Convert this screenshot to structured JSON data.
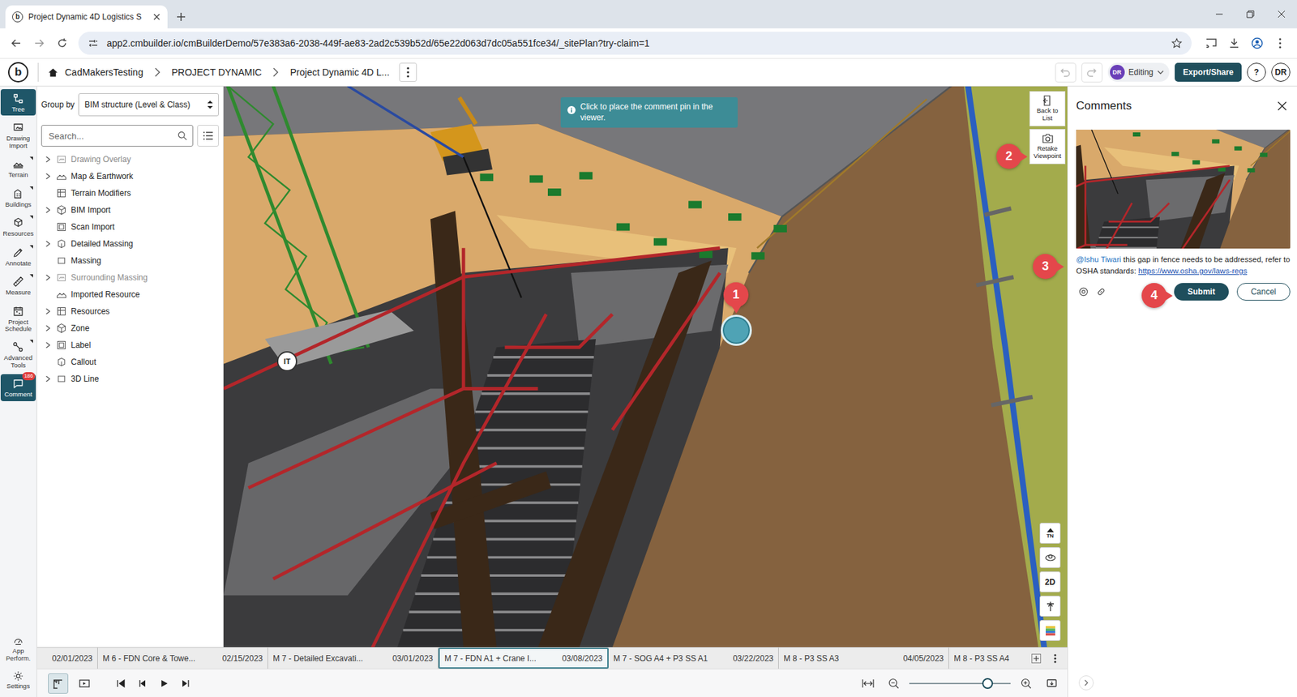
{
  "browser": {
    "tab_title": "Project Dynamic 4D Logistics S",
    "url": "app2.cmbuilder.io/cmBuilderDemo/57e383a6-2038-449f-ae83-2ad2c539b52d/65e22d063d7dc05a551fce34/_sitePlan?try-claim=1"
  },
  "app_header": {
    "logo": "b",
    "breadcrumbs": [
      "CadMakersTesting",
      "PROJECT DYNAMIC",
      "Project Dynamic 4D L..."
    ],
    "undo_disabled": true,
    "redo_disabled": true,
    "editor_initials": "DR",
    "mode": "Editing",
    "export_button": "Export/Share",
    "help": "?",
    "avatar": "DR"
  },
  "rail": {
    "items": [
      {
        "label": "Tree",
        "selected": true,
        "submenu": false,
        "badge": ""
      },
      {
        "label": "Drawing Import",
        "selected": false,
        "submenu": false,
        "badge": ""
      },
      {
        "label": "Terrain",
        "selected": false,
        "submenu": true,
        "badge": ""
      },
      {
        "label": "Buildings",
        "selected": false,
        "submenu": true,
        "badge": ""
      },
      {
        "label": "Resources",
        "selected": false,
        "submenu": true,
        "badge": ""
      },
      {
        "label": "Annotate",
        "selected": false,
        "submenu": true,
        "badge": ""
      },
      {
        "label": "Measure",
        "selected": false,
        "submenu": true,
        "badge": ""
      },
      {
        "label": "Project Schedule",
        "selected": false,
        "submenu": false,
        "badge": ""
      },
      {
        "label": "Advanced Tools",
        "selected": false,
        "submenu": true,
        "badge": ""
      },
      {
        "label": "Comment",
        "selected": true,
        "submenu": false,
        "badge": "186"
      }
    ],
    "bottom": [
      {
        "label": "App Perform."
      },
      {
        "label": "Settings"
      }
    ]
  },
  "tree_panel": {
    "group_by_label": "Group by",
    "group_by_value": "BIM structure (Level & Class)",
    "search_placeholder": "Search...",
    "items": [
      {
        "label": "Drawing Overlay",
        "expandable": true,
        "expanded": false,
        "disabled": true
      },
      {
        "label": "Map & Earthwork",
        "expandable": true,
        "expanded": false,
        "disabled": false
      },
      {
        "label": "Terrain Modifiers",
        "expandable": false,
        "expanded": false,
        "disabled": false
      },
      {
        "label": "BIM Import",
        "expandable": true,
        "expanded": false,
        "disabled": false
      },
      {
        "label": "Scan Import",
        "expandable": false,
        "expanded": false,
        "disabled": false
      },
      {
        "label": "Detailed Massing",
        "expandable": true,
        "expanded": false,
        "disabled": false
      },
      {
        "label": "Massing",
        "expandable": false,
        "expanded": false,
        "disabled": false
      },
      {
        "label": "Surrounding Massing",
        "expandable": true,
        "expanded": false,
        "disabled": true
      },
      {
        "label": "Imported Resource",
        "expandable": false,
        "expanded": false,
        "disabled": false
      },
      {
        "label": "Resources",
        "expandable": true,
        "expanded": false,
        "disabled": false
      },
      {
        "label": "Zone",
        "expandable": true,
        "expanded": false,
        "disabled": false
      },
      {
        "label": "Label",
        "expandable": true,
        "expanded": false,
        "disabled": false
      },
      {
        "label": "Callout",
        "expandable": false,
        "expanded": false,
        "disabled": false
      },
      {
        "label": "3D Line",
        "expandable": true,
        "expanded": false,
        "disabled": false
      }
    ]
  },
  "viewer": {
    "hint": "Click to place the comment pin in the viewer.",
    "tools": [
      {
        "label": "Back to List"
      },
      {
        "label": "Retake Viewpoint"
      }
    ],
    "pin_initials": "IT",
    "compass_label": "TN",
    "view_mode_label": "2D"
  },
  "comments": {
    "title": "Comments",
    "mention": "@Ishu Tiwari",
    "text": "this gap in fence needs to be addressed, refer to OSHA standards:",
    "link": "https://www.osha.gov/laws-regs",
    "submit": "Submit",
    "cancel": "Cancel"
  },
  "timeline": {
    "segments": [
      {
        "name": "",
        "date": "02/01/2023",
        "selected": false
      },
      {
        "name": "M 6 - FDN Core & Towe...",
        "date": "02/15/2023",
        "selected": false
      },
      {
        "name": "M 7 - Detailed Excavati...",
        "date": "03/01/2023",
        "selected": false
      },
      {
        "name": "M 7 - FDN A1 + Crane I...",
        "date": "03/08/2023",
        "selected": true
      },
      {
        "name": "M 7 - SOG A4 + P3 SS A1",
        "date": "03/22/2023",
        "selected": false
      },
      {
        "name": "M 8 - P3 SS A3",
        "date": "04/05/2023",
        "selected": false
      },
      {
        "name": "M 8 - P3 SS A4",
        "date": "",
        "selected": false
      }
    ]
  },
  "controls": {
    "mode_toggles": [
      {
        "selected": true
      },
      {
        "selected": false
      }
    ],
    "zoom_level": 0.77
  },
  "markers": [
    {
      "label": "1",
      "kind": "down"
    },
    {
      "label": "2",
      "kind": "right"
    },
    {
      "label": "3",
      "kind": "right"
    },
    {
      "label": "4",
      "kind": "right"
    }
  ]
}
